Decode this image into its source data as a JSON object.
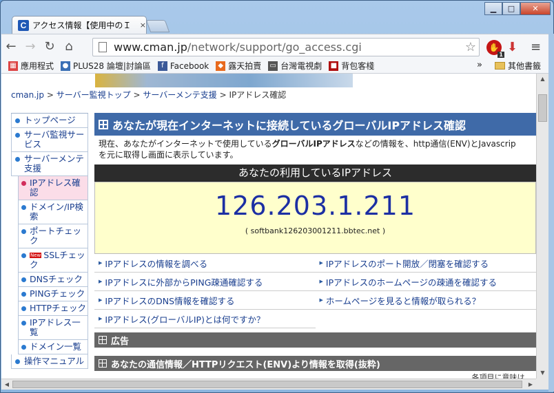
{
  "window": {
    "tab_title": "アクセス情報【使用中のＩ",
    "tab_close": "×",
    "favicon": "C",
    "min": "▁",
    "max": "□",
    "close": "✕"
  },
  "toolbar": {
    "url_host": "www.cman.jp",
    "url_path": "/network/support/go_access.cgi",
    "back": "←",
    "forward": "→",
    "reload": "↻",
    "home": "⌂",
    "star": "☆",
    "menu": "≡",
    "ext_badge": "1"
  },
  "bookmarks": {
    "items": [
      {
        "label": "應用程式",
        "icon": "apps-icon",
        "color": "#d44"
      },
      {
        "label": "PLUS28 論壇|討論區",
        "icon": "plus28-icon",
        "color": "#3a6fb5"
      },
      {
        "label": "Facebook",
        "icon": "facebook-icon",
        "color": "#3b5998"
      },
      {
        "label": "露天拍賣",
        "icon": "ruten-icon",
        "color": "#e86a1e"
      },
      {
        "label": "台灣電視劇",
        "icon": "tv-icon",
        "color": "#555"
      },
      {
        "label": "背包客棧",
        "icon": "backpacker-icon",
        "color": "#b01010"
      }
    ],
    "more": "»",
    "other": "其他書籤"
  },
  "breadcrumb": {
    "root": "cman.jp",
    "sep": ">",
    "l1": "サーバー監視トップ",
    "l2": "サーバーメンテ支援",
    "l3": "IPアドレス確認"
  },
  "sidebar": {
    "items": [
      {
        "label": "トップページ",
        "sub": false
      },
      {
        "label": "サーバ監視サービス",
        "sub": false
      },
      {
        "label": "サーバーメンテ支援",
        "sub": false
      },
      {
        "label": "IPアドレス確認",
        "sub": true,
        "active": true
      },
      {
        "label": "ドメイン/IP検索",
        "sub": true
      },
      {
        "label": "ポートチェック",
        "sub": true
      },
      {
        "label": "SSLチェック",
        "sub": true,
        "new": "New"
      },
      {
        "label": "DNSチェック",
        "sub": true
      },
      {
        "label": "PINGチェック",
        "sub": true
      },
      {
        "label": "HTTPチェック",
        "sub": true
      },
      {
        "label": "IPアドレス一覧",
        "sub": true
      },
      {
        "label": "ドメイン一覧",
        "sub": true
      },
      {
        "label": "操作マニュアル",
        "sub": false
      }
    ]
  },
  "main": {
    "heading": "あなたが現在インターネットに接続しているグローバルIPアドレス確認",
    "intro_pre": "現在、あなたがインターネットで使用している",
    "intro_bold": "グローバルIPアドレス",
    "intro_post": "などの情報を、http通信(ENV)とJavascrip",
    "intro_line2": "を元に取得し画面に表示しています。",
    "ip_title": "あなたの利用しているIPアドレス",
    "ip": "126.203.1.211",
    "host": "( softbank126203001211.bbtec.net )",
    "links": [
      "IPアドレスの情報を調べる",
      "IPアドレスのポート開放／閉塞を確認する",
      "IPアドレスに外部からPING疎通確認する",
      "IPアドレスのホームページの疎通を確認する",
      "IPアドレスのDNS情報を確認する",
      "ホームページを見ると情報が取られる？",
      "IPアドレス(グローバルIP)とは何ですか？"
    ],
    "ad": "広告",
    "env_heading": "あなたの通信情報／HTTPリクエスト(ENV)より情報を取得(抜粋)",
    "tail": "各項目に意味は..."
  }
}
